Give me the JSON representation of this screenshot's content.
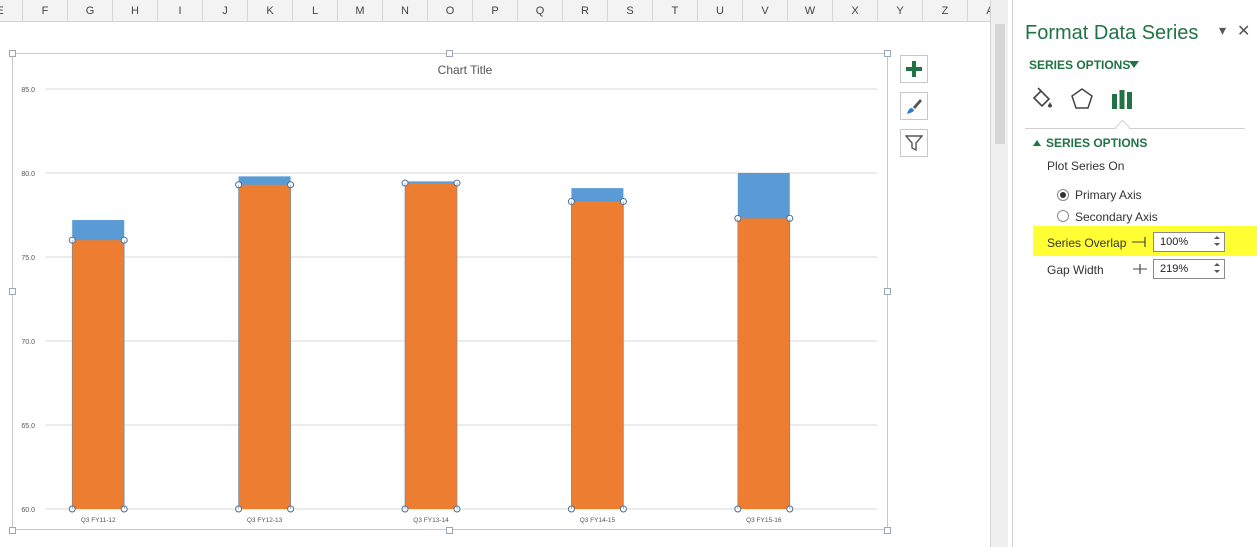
{
  "sheet": {
    "columns": [
      "E",
      "F",
      "G",
      "H",
      "I",
      "J",
      "K",
      "L",
      "M",
      "N",
      "O",
      "P",
      "Q",
      "R",
      "S",
      "T",
      "U",
      "V",
      "W",
      "X",
      "Y",
      "Z",
      "A"
    ]
  },
  "chart": {
    "buttons": [
      {
        "name": "chart-elements-button",
        "icon": "plus-icon"
      },
      {
        "name": "chart-styles-button",
        "icon": "paintbrush-icon"
      },
      {
        "name": "chart-filters-button",
        "icon": "filter-icon"
      }
    ]
  },
  "chart_data": {
    "type": "bar",
    "title": "Chart Title",
    "categories": [
      "Q3 FY11-12",
      "Q3 FY12-13",
      "Q3 FY13-14",
      "Q3 FY14-15",
      "Q3 FY15-16"
    ],
    "series": [
      {
        "values": [
          77.2,
          79.8,
          79.5,
          79.1,
          80.0
        ],
        "color": "#5b9bd5"
      },
      {
        "values": [
          76.0,
          79.3,
          79.4,
          78.3,
          77.3
        ],
        "color": "#ed7d31"
      }
    ],
    "ylim": [
      60,
      85
    ],
    "yticks": [
      "60.0",
      "65.0",
      "70.0",
      "75.0",
      "80.0",
      "85.0"
    ],
    "grid": true,
    "overlap": true,
    "xlabel": "",
    "ylabel": ""
  },
  "pane": {
    "title": "Format Data Series",
    "tab_label": "SERIES OPTIONS",
    "section_label": "SERIES OPTIONS",
    "plot_series_on": "Plot Series On",
    "primary_axis": "Primary Axis",
    "secondary_axis": "Secondary Axis",
    "series_overlap_label": "Series Overlap",
    "series_overlap_value": "100%",
    "gap_width_label": "Gap Width",
    "gap_width_value": "219%",
    "icons": [
      "fill-line-icon",
      "effects-icon",
      "series-options-icon"
    ],
    "accent": "#217346",
    "highlight": "#ffff33"
  }
}
